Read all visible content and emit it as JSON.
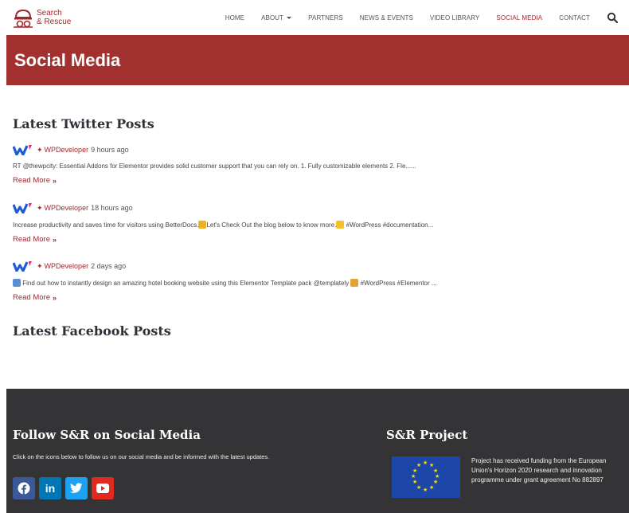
{
  "brand": {
    "line1": "Search",
    "line2": "& Rescue",
    "color": "#a0282c"
  },
  "nav": {
    "items": [
      {
        "label": "HOME"
      },
      {
        "label": "ABOUT"
      },
      {
        "label": "PARTNERS"
      },
      {
        "label": "NEWS & EVENTS"
      },
      {
        "label": "VIDEO LIBRARY"
      },
      {
        "label": "SOCIAL MEDIA"
      },
      {
        "label": "CONTACT"
      }
    ],
    "active": "SOCIAL MEDIA",
    "search_icon": "search-icon"
  },
  "banner": {
    "title": "Social Media",
    "color": "#a2302e"
  },
  "twitter": {
    "title": "Latest Twitter Posts",
    "posts": [
      {
        "author": "WPDeveloper",
        "time": "9 hours ago",
        "text": "RT @thewpcity: Essential Addons for Elementor provides solid customer support that you can rely on. 1. Fully customizable elements 2. Fle......",
        "read_more": "Read More"
      },
      {
        "author": "WPDeveloper",
        "time": "18 hours ago",
        "text_before": "Increase productivity and saves time for visitors using BetterDocs.",
        "text_mid": "Let's Check Out the blog below to know more.",
        "text_after": " #WordPress #documentation...",
        "read_more": "Read More"
      },
      {
        "author": "WPDeveloper",
        "time": "2 days ago",
        "text_before": " Find out how to instantly design an amazing hotel booking website using this Elementor Template pack @templately ",
        "text_after": " #WordPress #Elementor ...",
        "read_more": "Read More"
      }
    ]
  },
  "facebook": {
    "title": "Latest Facebook Posts"
  },
  "footer": {
    "follow_title": "Follow S&R on Social Media",
    "follow_text": "Click on the icons below to follow us on our social media and be informed with the latest updates.",
    "social": [
      {
        "name": "facebook-icon",
        "color": "#3b5998"
      },
      {
        "name": "linkedin-icon",
        "color": "#0077b5"
      },
      {
        "name": "twitter-icon",
        "color": "#1da1f2"
      },
      {
        "name": "youtube-icon",
        "color": "#e02a20"
      }
    ],
    "project_title": "S&R Project",
    "project_text": "Project has received funding from the European Union's Horizon 2020 research and innovation programme under grant agreement No 882897",
    "background": "#343436"
  }
}
